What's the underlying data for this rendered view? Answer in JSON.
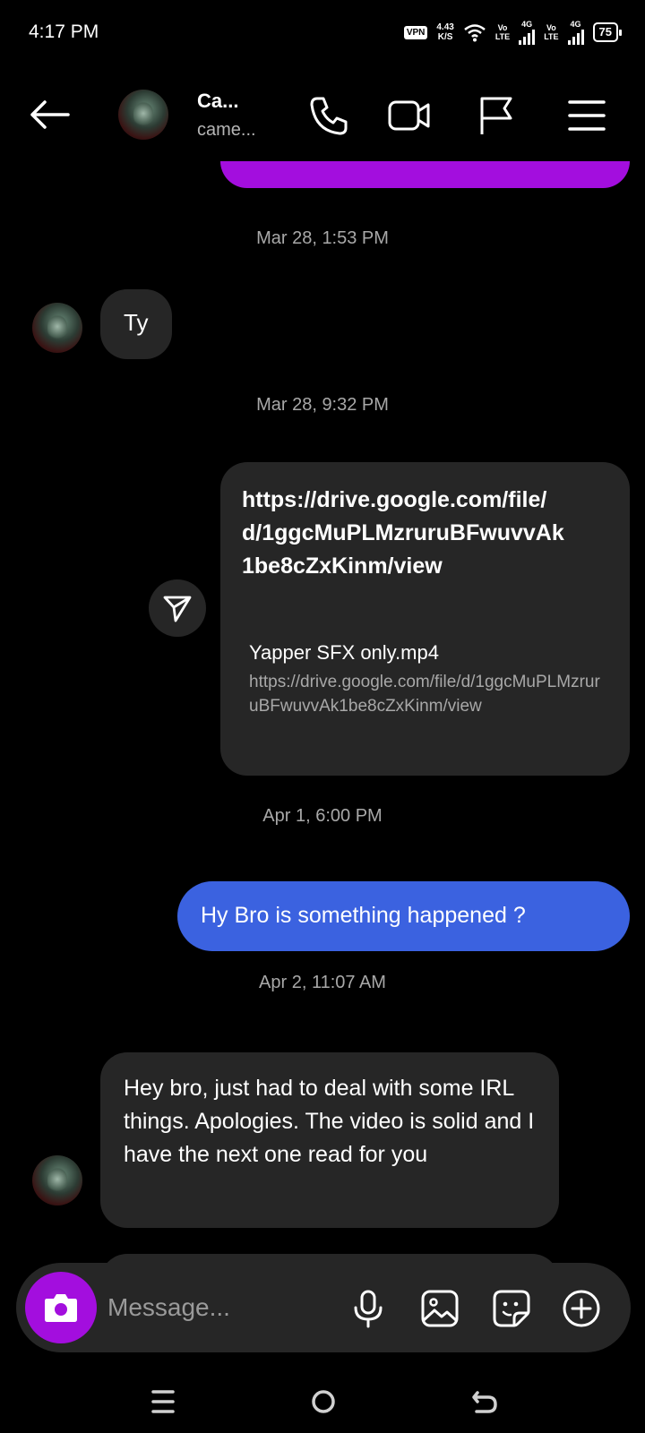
{
  "status_bar": {
    "time": "4:17 PM",
    "vpn": "VPN",
    "net_speed_value": "4.43",
    "net_speed_unit": "K/S",
    "sim1_volte_top": "Vo",
    "sim1_volte_bottom": "LTE",
    "sim1_network": "4G",
    "sim2_volte_top": "Vo",
    "sim2_volte_bottom": "LTE",
    "sim2_network": "4G",
    "battery": "75"
  },
  "header": {
    "contact_name": "Ca...",
    "contact_username": "came...",
    "icons": [
      "back-arrow-icon",
      "phone-icon",
      "video-camera-icon",
      "flag-icon",
      "menu-icon"
    ]
  },
  "messages": {
    "timestamp_1": "Mar 28, 1:53 PM",
    "reply_ty": "Ty",
    "timestamp_2": "Mar 28, 9:32 PM",
    "link_message": "https://drive.google.com/file/d/1ggcMuPLMzruruBFwuvvAk1be8cZxKinm/view",
    "link_preview_title": "Yapper SFX only.mp4",
    "link_preview_url": "https://drive.google.com/file/d/1ggcMuPLMzruruBFwuvvAk1be8cZxKinm/view",
    "timestamp_3": "Apr 1, 6:00 PM",
    "outgoing_text": "Hy Bro is something happened ?",
    "timestamp_4": "Apr 2, 11:07 AM",
    "incoming_long": "Hey bro, just had to deal with some IRL things. Apologies. The video is solid and I have the next one read for you"
  },
  "composer": {
    "placeholder": "Message...",
    "icons": [
      "camera-icon",
      "microphone-icon",
      "gallery-icon",
      "sticker-icon",
      "plus-icon"
    ]
  },
  "colors": {
    "background": "#000000",
    "incoming_bubble": "#262626",
    "outgoing_bubble_blue": "#3b62e0",
    "outgoing_bubble_purple": "#a30ede",
    "timestamp_text": "#a8a8a8"
  }
}
